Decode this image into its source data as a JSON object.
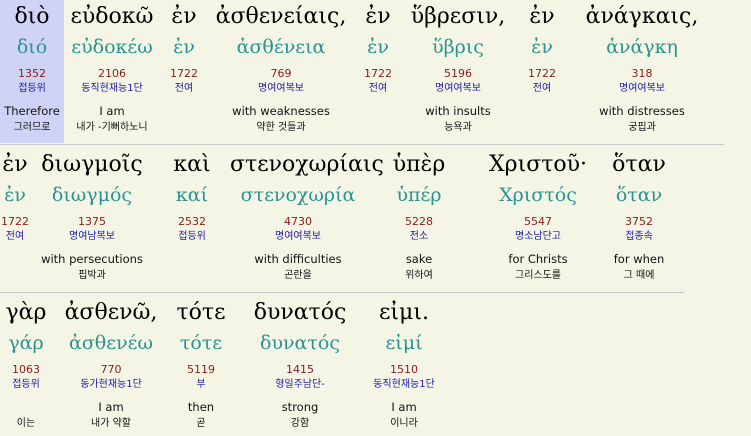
{
  "lines": [
    {
      "words": [
        {
          "greek": "διὸ",
          "lemma": "διό",
          "strong": "1352",
          "parse": "접등위",
          "gloss": "Therefore",
          "korean": "그러므로",
          "highlight": true
        },
        {
          "greek": "εὐδοκῶ",
          "lemma": "εὐδοκέω",
          "strong": "2106",
          "parse": "동직현재능1단",
          "gloss": "I am",
          "korean": "내가 -기뻐하노니"
        },
        {
          "greek": "ἐν",
          "lemma": "ἐν",
          "strong": "1722",
          "parse": "전여",
          "gloss": "",
          "korean": ""
        },
        {
          "greek": "ἀσθενείαις,",
          "lemma": "ἀσθένεια",
          "strong": "769",
          "parse": "명여여복보",
          "gloss": "with weaknesses",
          "korean": "약한 것들과"
        },
        {
          "greek": "ἐν",
          "lemma": "ἐν",
          "strong": "1722",
          "parse": "전여",
          "gloss": "",
          "korean": ""
        },
        {
          "greek": "ὕβρεσιν,",
          "lemma": "ὕβρις",
          "strong": "5196",
          "parse": "명여여복보",
          "gloss": "with insults",
          "korean": "능욕과"
        },
        {
          "greek": "ἐν",
          "lemma": "ἐν",
          "strong": "1722",
          "parse": "전여",
          "gloss": "",
          "korean": ""
        },
        {
          "greek": "ἀνάγκαις,",
          "lemma": "ἀνάγκη",
          "strong": "318",
          "parse": "명여여복보",
          "gloss": "with distresses",
          "korean": "궁핍과"
        }
      ]
    },
    {
      "words": [
        {
          "greek": "ἐν",
          "lemma": "ἐν",
          "strong": "1722",
          "parse": "전여",
          "gloss": "",
          "korean": ""
        },
        {
          "greek": "διωγμοῖς",
          "lemma": "διωγμός",
          "strong": "1375",
          "parse": "명여남복보",
          "gloss": "with persecutions",
          "korean": "핍박과"
        },
        {
          "greek": "καὶ",
          "lemma": "καί",
          "strong": "2532",
          "parse": "접등위",
          "gloss": "",
          "korean": ""
        },
        {
          "greek": "στενοχωρίαις",
          "lemma": "στενοχωρία",
          "strong": "4730",
          "parse": "명여여복보",
          "gloss": "with difficulties",
          "korean": "곤란을"
        },
        {
          "greek": "ὑπὲρ",
          "lemma": "ὑπέρ",
          "strong": "5228",
          "parse": "전소",
          "gloss": "sake",
          "korean": "위하여"
        },
        {
          "greek": "Χριστοῦ·",
          "lemma": "Χριστός",
          "strong": "5547",
          "parse": "명소남단고",
          "gloss": "for Christs",
          "korean": "그리스도를"
        },
        {
          "greek": "ὅταν",
          "lemma": "ὅταν",
          "strong": "3752",
          "parse": "접종속",
          "gloss": "for when",
          "korean": "그 때에"
        }
      ]
    },
    {
      "words": [
        {
          "greek": "γὰρ",
          "lemma": "γάρ",
          "strong": "1063",
          "parse": "접등위",
          "gloss": "",
          "korean": "이는"
        },
        {
          "greek": "ἀσθενῶ,",
          "lemma": "ἀσθενέω",
          "strong": "770",
          "parse": "동가현재능1단",
          "gloss": "I am",
          "korean": "내가 약할"
        },
        {
          "greek": "τότε",
          "lemma": "τότε",
          "strong": "5119",
          "parse": "부",
          "gloss": "then",
          "korean": "곧"
        },
        {
          "greek": "δυνατός",
          "lemma": "δυνατός",
          "strong": "1415",
          "parse": "형일주남단-",
          "gloss": "strong",
          "korean": "강함"
        },
        {
          "greek": "εἰμι.",
          "lemma": "εἰμί",
          "strong": "1510",
          "parse": "동직현재능1단",
          "gloss": "I am",
          "korean": "이니라"
        }
      ]
    }
  ]
}
